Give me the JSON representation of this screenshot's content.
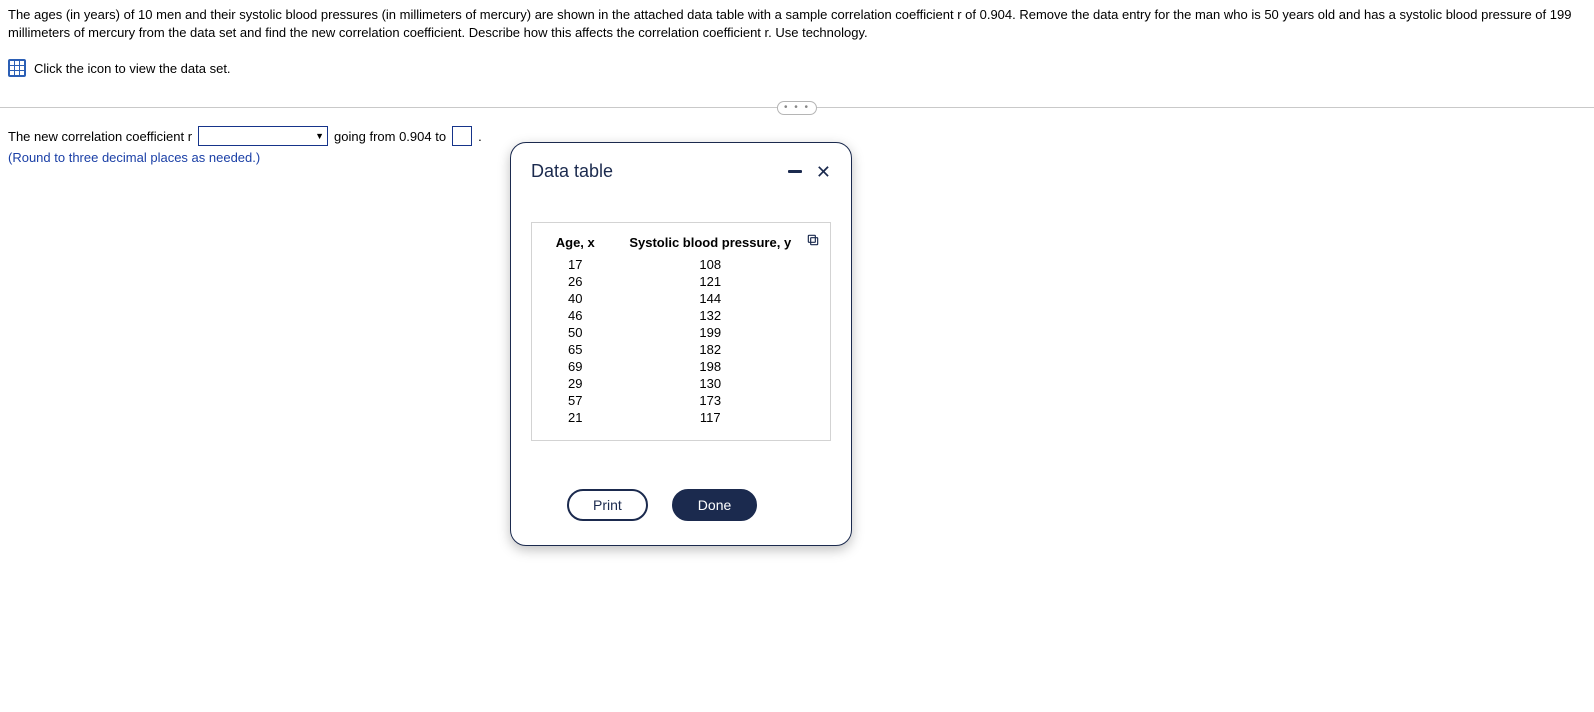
{
  "question": {
    "text": "The ages (in years) of 10 men and their systolic blood pressures (in millimeters of mercury) are shown in the attached data table with a sample correlation coefficient r of 0.904. Remove the data entry for the man who is 50 years old and has a systolic blood pressure of 199 millimeters of mercury from the data set and find the new correlation coefficient. Describe how this affects the correlation coefficient r. Use technology."
  },
  "dataset_link": {
    "text": "Click the icon to view the data set."
  },
  "answer": {
    "prefix": "The new correlation coefficient r",
    "middle": "going from 0.904 to",
    "suffix": ".",
    "hint": "(Round to three decimal places as needed.)",
    "dropdown_value": "",
    "input_value": ""
  },
  "divider_dots": "• • •",
  "modal": {
    "title": "Data table",
    "columns": {
      "x": "Age, x",
      "y": "Systolic blood pressure, y"
    },
    "rows": [
      {
        "x": "17",
        "y": "108"
      },
      {
        "x": "26",
        "y": "121"
      },
      {
        "x": "40",
        "y": "144"
      },
      {
        "x": "46",
        "y": "132"
      },
      {
        "x": "50",
        "y": "199"
      },
      {
        "x": "65",
        "y": "182"
      },
      {
        "x": "69",
        "y": "198"
      },
      {
        "x": "29",
        "y": "130"
      },
      {
        "x": "57",
        "y": "173"
      },
      {
        "x": "21",
        "y": "117"
      }
    ],
    "buttons": {
      "print": "Print",
      "done": "Done"
    }
  },
  "chart_data": {
    "type": "table",
    "title": "Data table",
    "columns": [
      "Age, x",
      "Systolic blood pressure, y"
    ],
    "rows": [
      [
        17,
        108
      ],
      [
        26,
        121
      ],
      [
        40,
        144
      ],
      [
        46,
        132
      ],
      [
        50,
        199
      ],
      [
        65,
        182
      ],
      [
        69,
        198
      ],
      [
        29,
        130
      ],
      [
        57,
        173
      ],
      [
        21,
        117
      ]
    ]
  }
}
